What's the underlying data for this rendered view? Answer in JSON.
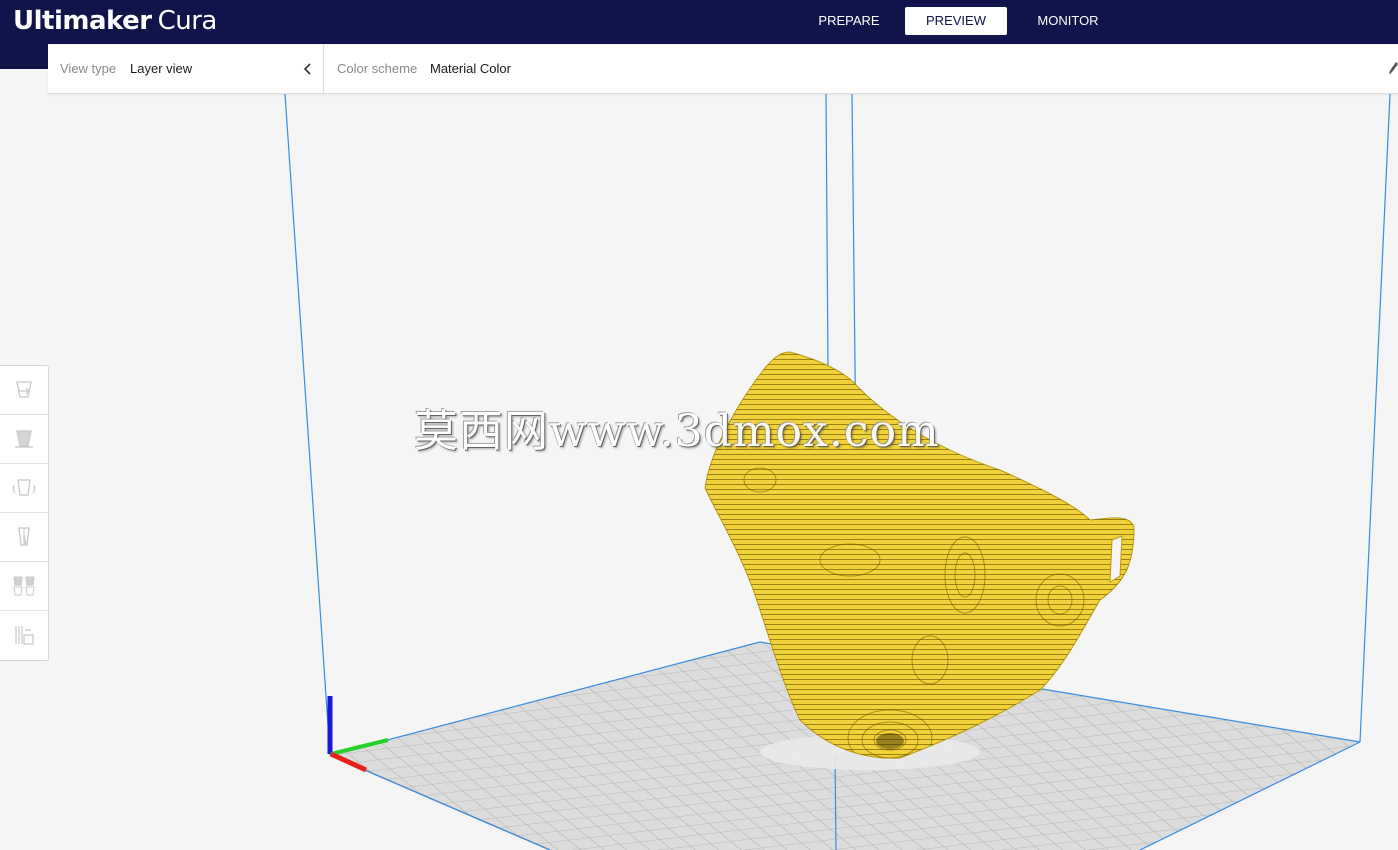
{
  "app": {
    "brand": "Ultimaker",
    "product": "Cura"
  },
  "stages": [
    {
      "label": "PREPARE",
      "active": false
    },
    {
      "label": "PREVIEW",
      "active": true
    },
    {
      "label": "MONITOR",
      "active": false
    }
  ],
  "view_panel": {
    "view_type_label": "View type",
    "view_type_value": "Layer view",
    "color_scheme_label": "Color scheme",
    "color_scheme_value": "Material Color"
  },
  "tools": [
    {
      "name": "move-tool",
      "icon": "move-icon"
    },
    {
      "name": "scale-tool",
      "icon": "scale-icon"
    },
    {
      "name": "rotate-tool",
      "icon": "rotate-icon"
    },
    {
      "name": "mirror-tool",
      "icon": "mirror-icon"
    },
    {
      "name": "per-model-settings-tool",
      "icon": "per-model-settings-icon"
    },
    {
      "name": "support-blocker-tool",
      "icon": "support-blocker-icon"
    }
  ],
  "scene": {
    "model_color": "#f2d23a",
    "model_line_color": "#4a3d00",
    "axis_x_color": "#e8201a",
    "axis_y_color": "#27d127",
    "axis_z_color": "#1818d8",
    "volume_edge_color": "#3a8ce0",
    "plate_color": "#d7d7d7"
  },
  "watermark": "莫西网www.3dmox.com"
}
